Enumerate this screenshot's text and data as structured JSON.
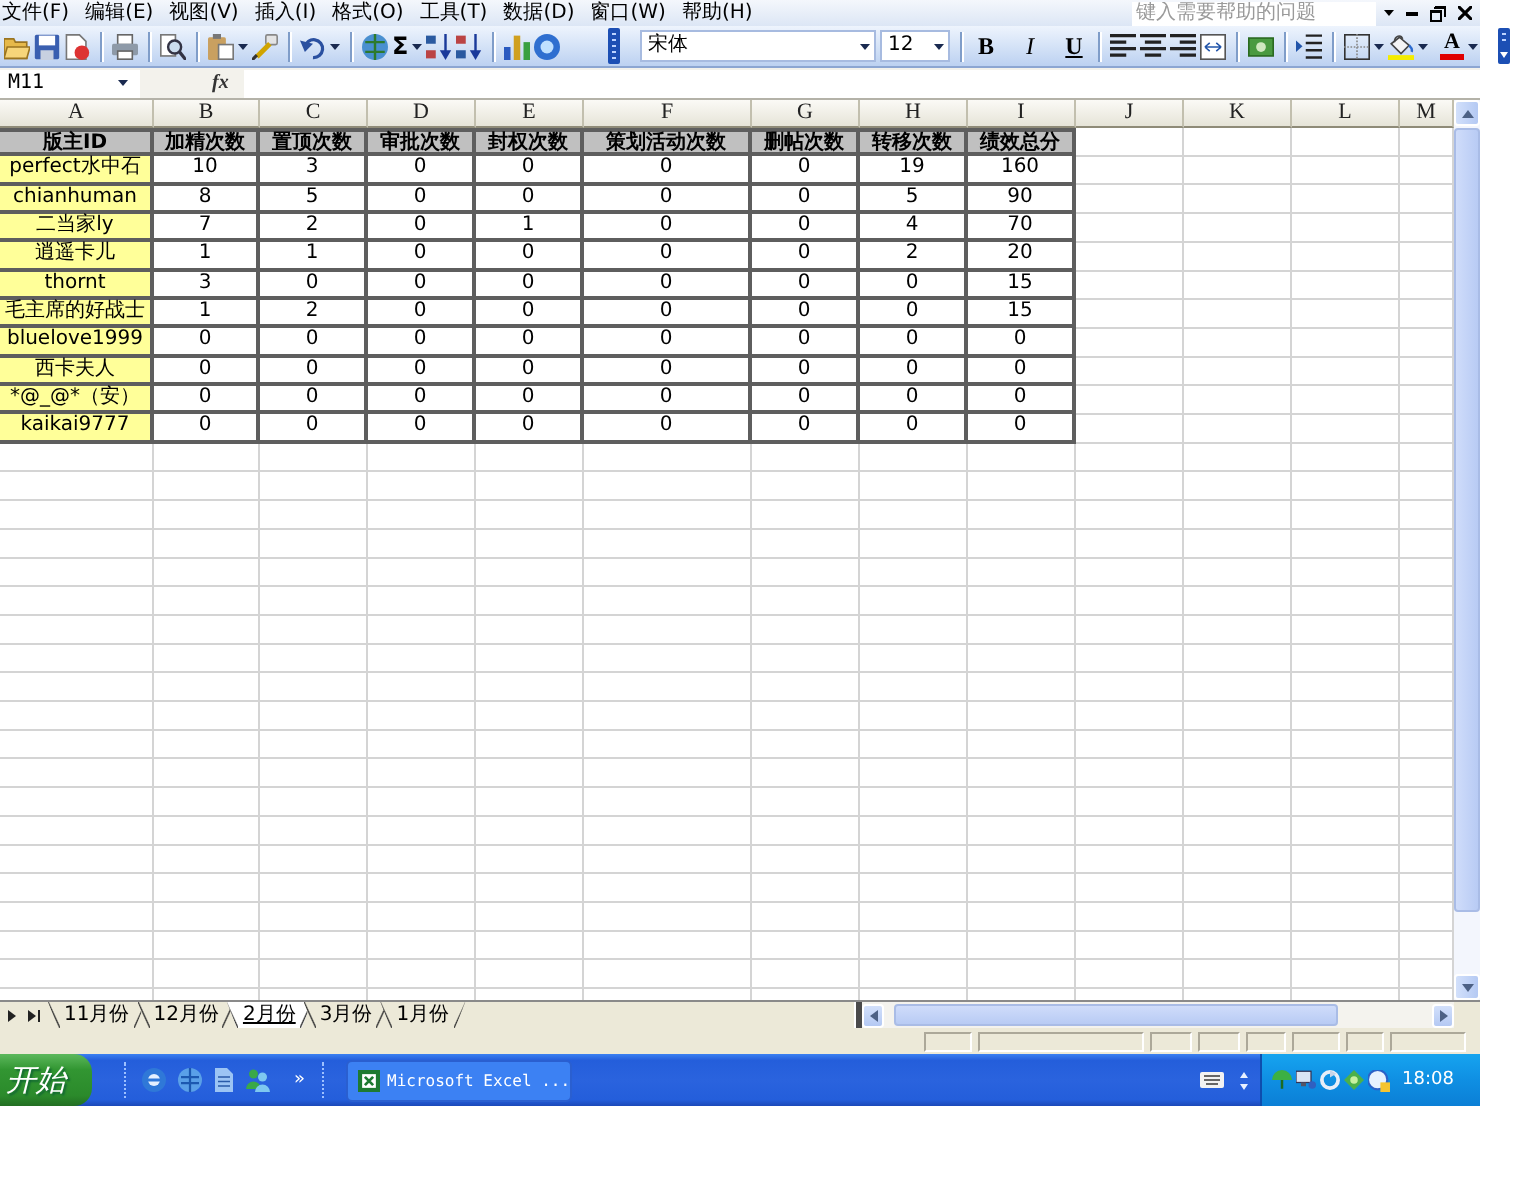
{
  "menu_bar": {
    "items": [
      "文件(F)",
      "编辑(E)",
      "视图(V)",
      "插入(I)",
      "格式(O)",
      "工具(T)",
      "数据(D)",
      "窗口(W)",
      "帮助(H)"
    ],
    "help_box": {
      "placeholder": "键入需要帮助的问题"
    }
  },
  "toolbar": {
    "autosum": "Σ",
    "font_name": "宋体",
    "font_size": "12",
    "format_buttons": [
      {
        "label": "B",
        "kind": "bold"
      },
      {
        "label": "I",
        "kind": "italic"
      },
      {
        "label": "U",
        "kind": "underline"
      }
    ],
    "font_color": "A"
  },
  "formula_bar": {
    "name_box": "M11",
    "function_label": "fx"
  },
  "sheet": {
    "columns": [
      "A",
      "B",
      "C",
      "D",
      "E",
      "F",
      "G",
      "H",
      "I",
      "J",
      "K",
      "L",
      "M"
    ],
    "header": [
      "版主ID",
      "加精次数",
      "置顶次数",
      "审批次数",
      "封权次数",
      "策划活动次数",
      "删帖次数",
      "转移次数",
      "绩效总分"
    ],
    "rows": [
      [
        "perfect水中石",
        "10",
        "3",
        "0",
        "0",
        "0",
        "0",
        "19",
        "160"
      ],
      [
        "chianhuman",
        "8",
        "5",
        "0",
        "0",
        "0",
        "0",
        "5",
        "90"
      ],
      [
        "二当家ly",
        "7",
        "2",
        "0",
        "1",
        "0",
        "0",
        "4",
        "70"
      ],
      [
        "逍遥卡儿",
        "1",
        "1",
        "0",
        "0",
        "0",
        "0",
        "2",
        "20"
      ],
      [
        "thornt",
        "3",
        "0",
        "0",
        "0",
        "0",
        "0",
        "0",
        "15"
      ],
      [
        "毛主席的好战士",
        "1",
        "2",
        "0",
        "0",
        "0",
        "0",
        "0",
        "15"
      ],
      [
        "bluelove1999",
        "0",
        "0",
        "0",
        "0",
        "0",
        "0",
        "0",
        "0"
      ],
      [
        "西卡夫人",
        "0",
        "0",
        "0",
        "0",
        "0",
        "0",
        "0",
        "0"
      ],
      [
        "*@_@*（安）",
        "0",
        "0",
        "0",
        "0",
        "0",
        "0",
        "0",
        "0"
      ],
      [
        "kaikai9777",
        "0",
        "0",
        "0",
        "0",
        "0",
        "0",
        "0",
        "0"
      ]
    ]
  },
  "sheet_tabs": [
    {
      "label": "11月份",
      "selected": false
    },
    {
      "label": "12月份",
      "selected": false
    },
    {
      "label": "2月份",
      "selected": true
    },
    {
      "label": "3月份",
      "selected": false
    },
    {
      "label": "1月份",
      "selected": false
    }
  ],
  "taskbar": {
    "start_button": "开始",
    "quick_launch_more": "»",
    "tasks": [
      "Microsoft Excel ..."
    ],
    "clock": "18:08"
  }
}
